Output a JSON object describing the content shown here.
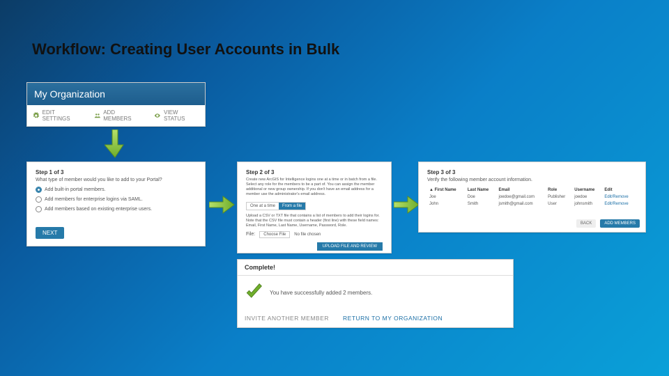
{
  "title": "Workflow: Creating User Accounts in Bulk",
  "org": {
    "title": "My Organization",
    "edit": "EDIT SETTINGS",
    "add": "ADD MEMBERS",
    "view": "VIEW STATUS"
  },
  "step1": {
    "heading": "Step 1 of 3",
    "sub": "What type of member would you like to add to your Portal?",
    "opt1": "Add built-in portal members.",
    "opt2": "Add members for enterprise logins via SAML.",
    "opt3": "Add members based on existing enterprise users.",
    "next": "NEXT"
  },
  "step2": {
    "heading": "Step 2 of 3",
    "desc": "Create new ArcGIS for Intelligence logins one at a time or in batch from a file. Select any role for the members to be a part of. You can assign the member additional or new group ownership. If you don't have an email address for a member use the administrator's email address.",
    "tab_one": "One at a time",
    "tab_file": "From a file",
    "upload_desc": "Upload a CSV or TXT file that contains a list of members to add their logins for. Note that the CSV file must contain a header (first line) with these field names: Email, First Name, Last Name, Username, Password, Role.",
    "file_label": "File:",
    "choose": "Choose File",
    "nofile": "No file chosen",
    "upload": "UPLOAD FILE AND REVIEW"
  },
  "step3": {
    "heading": "Step 3 of 3",
    "sub": "Verify the following member account information.",
    "cols": [
      "First Name",
      "Last Name",
      "Email",
      "Role",
      "Username",
      "Edit"
    ],
    "rows": [
      {
        "fn": "Joe",
        "ln": "Doe",
        "email": "joedoe@gmail.com",
        "role": "Publisher",
        "user": "joedoe",
        "edit": "Edit/Remove"
      },
      {
        "fn": "John",
        "ln": "Smith",
        "email": "jsmith@gmail.com",
        "role": "User",
        "user": "johnsmith",
        "edit": "Edit/Remove"
      }
    ],
    "back": "BACK",
    "add": "ADD MEMBERS"
  },
  "complete": {
    "heading": "Complete!",
    "msg": "You have successfully added 2 members.",
    "invite": "INVITE ANOTHER MEMBER",
    "return": "RETURN TO MY ORGANIZATION"
  }
}
